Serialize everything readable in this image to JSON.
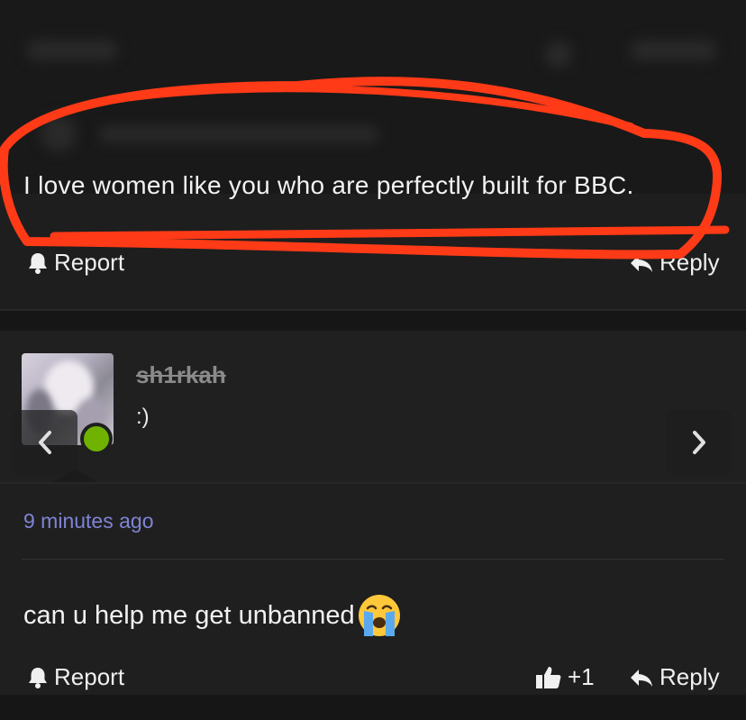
{
  "first_comment": {
    "text": "I love women like you who are perfectly built for BBC.",
    "report_label": "Report",
    "reply_label": "Reply"
  },
  "reply": {
    "username": "sh1rkah",
    "status_message": ":)",
    "timestamp": "9 minutes ago",
    "message": "can u help me get unbanned",
    "emoji": "crying-face-emoji",
    "report_label": "Report",
    "like_count": "+1",
    "reply_label": "Reply"
  },
  "colors": {
    "annotation": "#ff3a17",
    "timestamp": "#7f84d6",
    "online": "#6fb300"
  }
}
